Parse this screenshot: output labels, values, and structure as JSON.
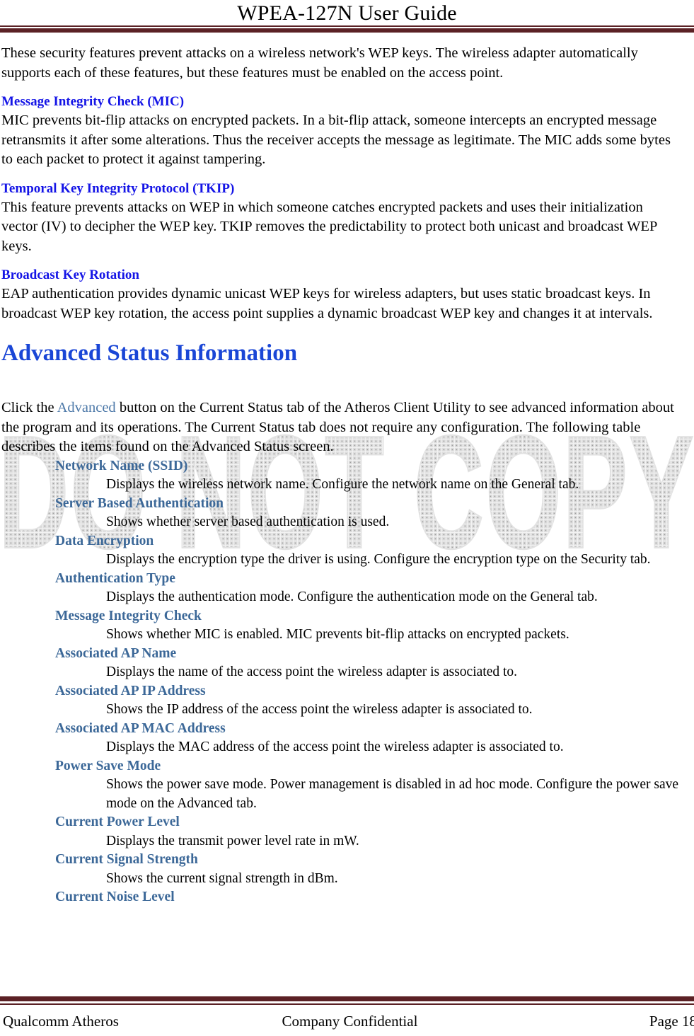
{
  "header": {
    "title": "WPEA-127N User Guide",
    "rule_color": "#5B2125"
  },
  "watermark": {
    "text": "DO NOT COPY",
    "color": "#D9D9D9"
  },
  "intro_paragraph": "These security features prevent attacks on a wireless network's WEP keys. The wireless adapter automatically supports each of these features, but these features must be enabled on the access point.",
  "sections": [
    {
      "heading": "Message Integrity Check (MIC)",
      "body": "MIC prevents bit-flip attacks on encrypted packets. In a bit-flip attack, someone intercepts an encrypted message retransmits it after some alterations. Thus the receiver accepts the message as legitimate. The MIC adds some bytes to each packet to protect it against tampering."
    },
    {
      "heading": "Temporal Key Integrity Protocol (TKIP)",
      "body": "This feature prevents attacks on WEP in which someone catches encrypted packets and uses their initialization vector (IV) to decipher the WEP key. TKIP removes the predictability to protect both unicast and broadcast WEP keys."
    },
    {
      "heading": "Broadcast Key Rotation",
      "body": "EAP authentication provides dynamic unicast WEP keys for wireless adapters, but uses static broadcast keys. In broadcast WEP key rotation, the access point supplies a dynamic broadcast WEP key and changes it at intervals."
    }
  ],
  "advanced_section": {
    "title": "Advanced Status Information",
    "intro_part1": "Click the ",
    "intro_link": "Advanced",
    "intro_part2": " button on the Current Status tab of the Atheros Client Utility to see advanced information about the program and its operations. The Current Status tab does not require any configuration. The following table describes the items found on the Advanced Status screen.",
    "terms": [
      {
        "term": "Network Name (SSID)",
        "definition": "Displays the wireless network name. Configure the network name on the General tab."
      },
      {
        "term": "Server Based Authentication",
        "definition": "Shows whether server based authentication is used."
      },
      {
        "term": "Data Encryption",
        "definition": "Displays the encryption type the driver is using. Configure the encryption type on the Security tab."
      },
      {
        "term": "Authentication Type",
        "definition": "Displays the authentication mode. Configure the authentication mode on the General tab."
      },
      {
        "term": "Message Integrity Check",
        "definition": "Shows whether MIC is enabled. MIC prevents bit-flip attacks on encrypted packets."
      },
      {
        "term": "Associated AP Name",
        "definition": "Displays the name of the access point the wireless adapter is associated to."
      },
      {
        "term": "Associated AP IP Address",
        "definition": "Shows the IP address of the access point the wireless adapter is associated to."
      },
      {
        "term": "Associated AP MAC Address",
        "definition": "Displays the MAC address of the access point the wireless adapter is associated to."
      },
      {
        "term": "Power Save Mode",
        "definition": "Shows the power save mode. Power management is disabled in ad hoc mode. Configure the power save mode on the Advanced tab."
      },
      {
        "term": "Current Power Level",
        "definition": "Displays the transmit power level rate in mW."
      },
      {
        "term": "Current Signal Strength",
        "definition": "Shows the current signal strength in dBm."
      },
      {
        "term": "Current Noise Level",
        "definition": ""
      }
    ]
  },
  "footer": {
    "left": "Qualcomm Atheros",
    "center": "Company Confidential",
    "right": "Page 18"
  }
}
